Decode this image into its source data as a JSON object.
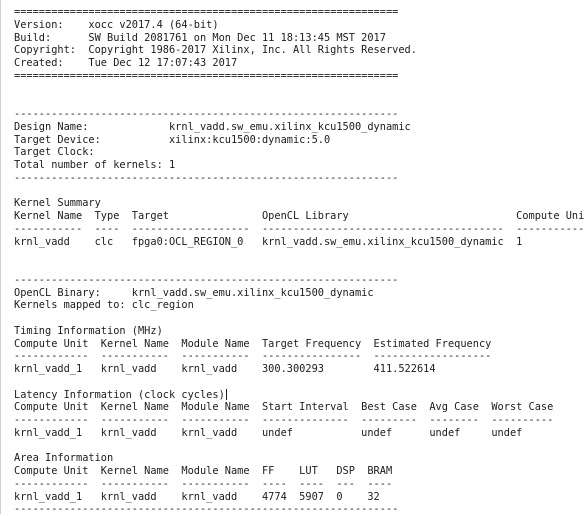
{
  "report": {
    "lines": [
      "==============================================================",
      "Version:    xocc v2017.4 (64-bit)",
      "Build:      SW Build 2081761 on Mon Dec 11 18:13:45 MST 2017",
      "Copyright:  Copyright 1986-2017 Xilinx, Inc. All Rights Reserved.",
      "Created:    Tue Dec 12 17:07:43 2017",
      "==============================================================",
      "",
      "",
      "--------------------------------------------------------------",
      "Design Name:             krnl_vadd.sw_emu.xilinx_kcu1500_dynamic",
      "Target Device:           xilinx:kcu1500:dynamic:5.0",
      "Target Clock:",
      "Total number of kernels: 1",
      "--------------------------------------------------------------",
      "",
      "Kernel Summary",
      "Kernel Name  Type  Target               OpenCL Library                           Compute Units",
      "-----------  ----  -------------------  ---------------------------------------  -------------",
      "krnl_vadd    clc   fpga0:OCL_REGION_0   krnl_vadd.sw_emu.xilinx_kcu1500_dynamic  1",
      "",
      "",
      "--------------------------------------------------------------",
      "OpenCL Binary:     krnl_vadd.sw_emu.xilinx_kcu1500_dynamic",
      "Kernels mapped to: clc_region",
      "",
      "Timing Information (MHz)",
      "Compute Unit  Kernel Name  Module Name  Target Frequency  Estimated Frequency",
      "------------  -----------  -----------  ----------------  -------------------",
      "krnl_vadd_1   krnl_vadd    krnl_vadd    300.300293        411.522614",
      "",
      "Latency Information (clock cycles)",
      "Compute Unit  Kernel Name  Module Name  Start Interval  Best Case  Avg Case  Worst Case",
      "------------  -----------  -----------  --------------  ---------  --------  ----------",
      "krnl_vadd_1   krnl_vadd    krnl_vadd    undef           undef      undef     undef",
      "",
      "Area Information",
      "Compute Unit  Kernel Name  Module Name  FF    LUT   DSP  BRAM",
      "------------  -----------  -----------  ----  ----  ---  ----",
      "krnl_vadd_1   krnl_vadd    krnl_vadd    4774  5907  0    32",
      "--------------------------------------------------------------"
    ]
  }
}
